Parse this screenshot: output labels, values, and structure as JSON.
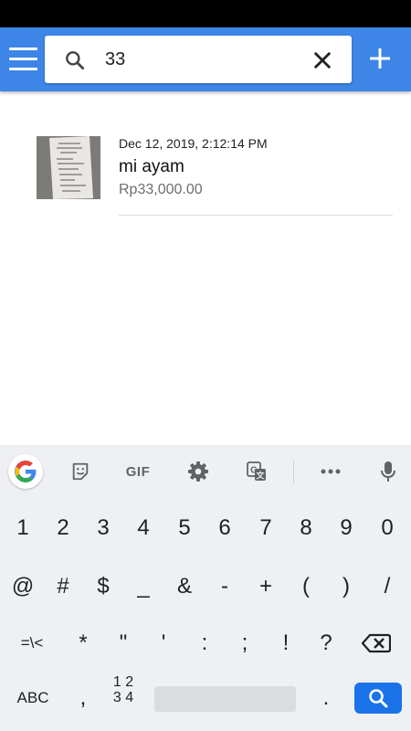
{
  "search": {
    "value": "33"
  },
  "entries": [
    {
      "date": "Dec 12, 2019, 2:12:14 PM",
      "title": "mi ayam",
      "amount": "Rp33,000.00"
    }
  ],
  "keyboard": {
    "row1": [
      "1",
      "2",
      "3",
      "4",
      "5",
      "6",
      "7",
      "8",
      "9",
      "0"
    ],
    "row2": [
      "@",
      "#",
      "$",
      "_",
      "&",
      "-",
      "+",
      "(",
      ")",
      "/"
    ],
    "row3": [
      "=\\<",
      "*",
      "\"",
      "'",
      ":",
      ";",
      "!",
      "?"
    ],
    "row4": {
      "abc": "ABC",
      "comma": ",",
      "num_top": "1 2",
      "num_bottom": "3 4",
      "period": "."
    },
    "toolbar": {
      "gif": "GIF"
    }
  },
  "colors": {
    "app_bar": "#3d85e6",
    "enter_key": "#1a73e8",
    "status_bar": "#000000"
  }
}
